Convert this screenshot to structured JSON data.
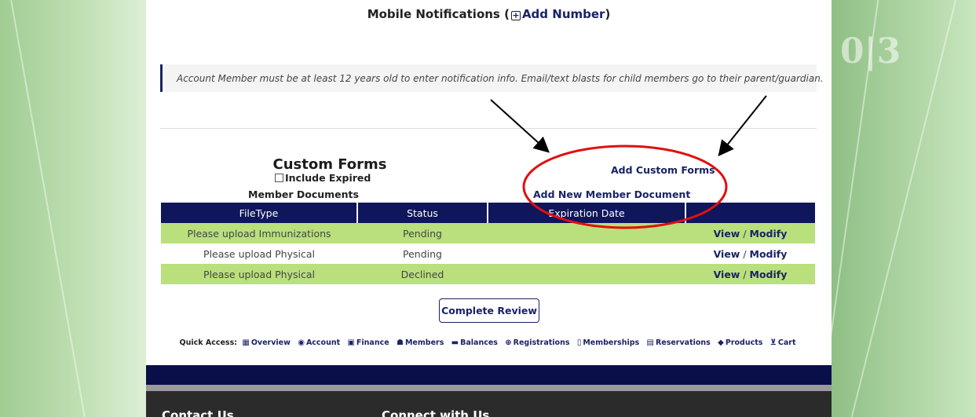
{
  "mobile": {
    "prefix": "Mobile Notifications (",
    "add_label": "Add Number",
    "suffix": ")"
  },
  "notice": "Account Member must be at least 12 years old to enter notification info. Email/text blasts for child members go to their parent/guardian.",
  "custom_forms": {
    "title": "Custom Forms",
    "include_expired": "Include Expired",
    "add_custom_forms": "Add Custom Forms"
  },
  "member_documents": {
    "title": "Member Documents",
    "add_label": "Add New Member Document",
    "columns": [
      "FileType",
      "Status",
      "Expiration Date",
      ""
    ],
    "rows": [
      {
        "filetype": "Please upload Immunizations",
        "status": "Pending",
        "expiration": "",
        "view": "View",
        "modify": "Modify"
      },
      {
        "filetype": "Please upload Physical",
        "status": "Pending",
        "expiration": "",
        "view": "View",
        "modify": "Modify"
      },
      {
        "filetype": "Please upload Physical",
        "status": "Declined",
        "expiration": "",
        "view": "View",
        "modify": "Modify"
      }
    ]
  },
  "complete_review": "Complete Review",
  "quick_access": {
    "label": "Quick Access:",
    "items": [
      {
        "icon": "overview-icon",
        "label": "Overview"
      },
      {
        "icon": "account-icon",
        "label": "Account"
      },
      {
        "icon": "finance-icon",
        "label": "Finance"
      },
      {
        "icon": "members-icon",
        "label": "Members"
      },
      {
        "icon": "balances-icon",
        "label": "Balances"
      },
      {
        "icon": "registrations-icon",
        "label": "Registrations"
      },
      {
        "icon": "memberships-icon",
        "label": "Memberships"
      },
      {
        "icon": "reservations-icon",
        "label": "Reservations"
      },
      {
        "icon": "products-icon",
        "label": "Products"
      },
      {
        "icon": "cart-icon",
        "label": "Cart"
      }
    ]
  },
  "footer": {
    "contact": "Contact Us",
    "connect": "Connect with Us"
  },
  "colors": {
    "navy": "#0f1659",
    "green_row": "#b9e07c",
    "annotation_red": "#e01010"
  }
}
